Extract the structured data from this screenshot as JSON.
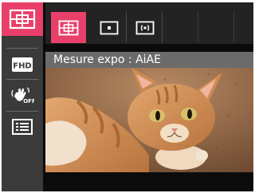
{
  "menu": {
    "items": [
      {
        "icon": "metering-icon",
        "state": "active"
      },
      {
        "icon": "video-fhd-icon",
        "label": "FHD"
      },
      {
        "icon": "stabilizer-off-icon",
        "label": "OFF"
      },
      {
        "icon": "menu-list-icon"
      }
    ]
  },
  "options": [
    {
      "icon": "metering-aiae-icon",
      "selected": true
    },
    {
      "icon": "metering-center-icon"
    },
    {
      "icon": "metering-spot-icon"
    }
  ],
  "status": {
    "label": "Mesure expo : AiAE"
  },
  "preview": {
    "subject": "cat-photo"
  },
  "colors": {
    "accent": "#e8406a",
    "menu_bg": "#3a3a3a",
    "label_bg": "#6b6b6b"
  }
}
